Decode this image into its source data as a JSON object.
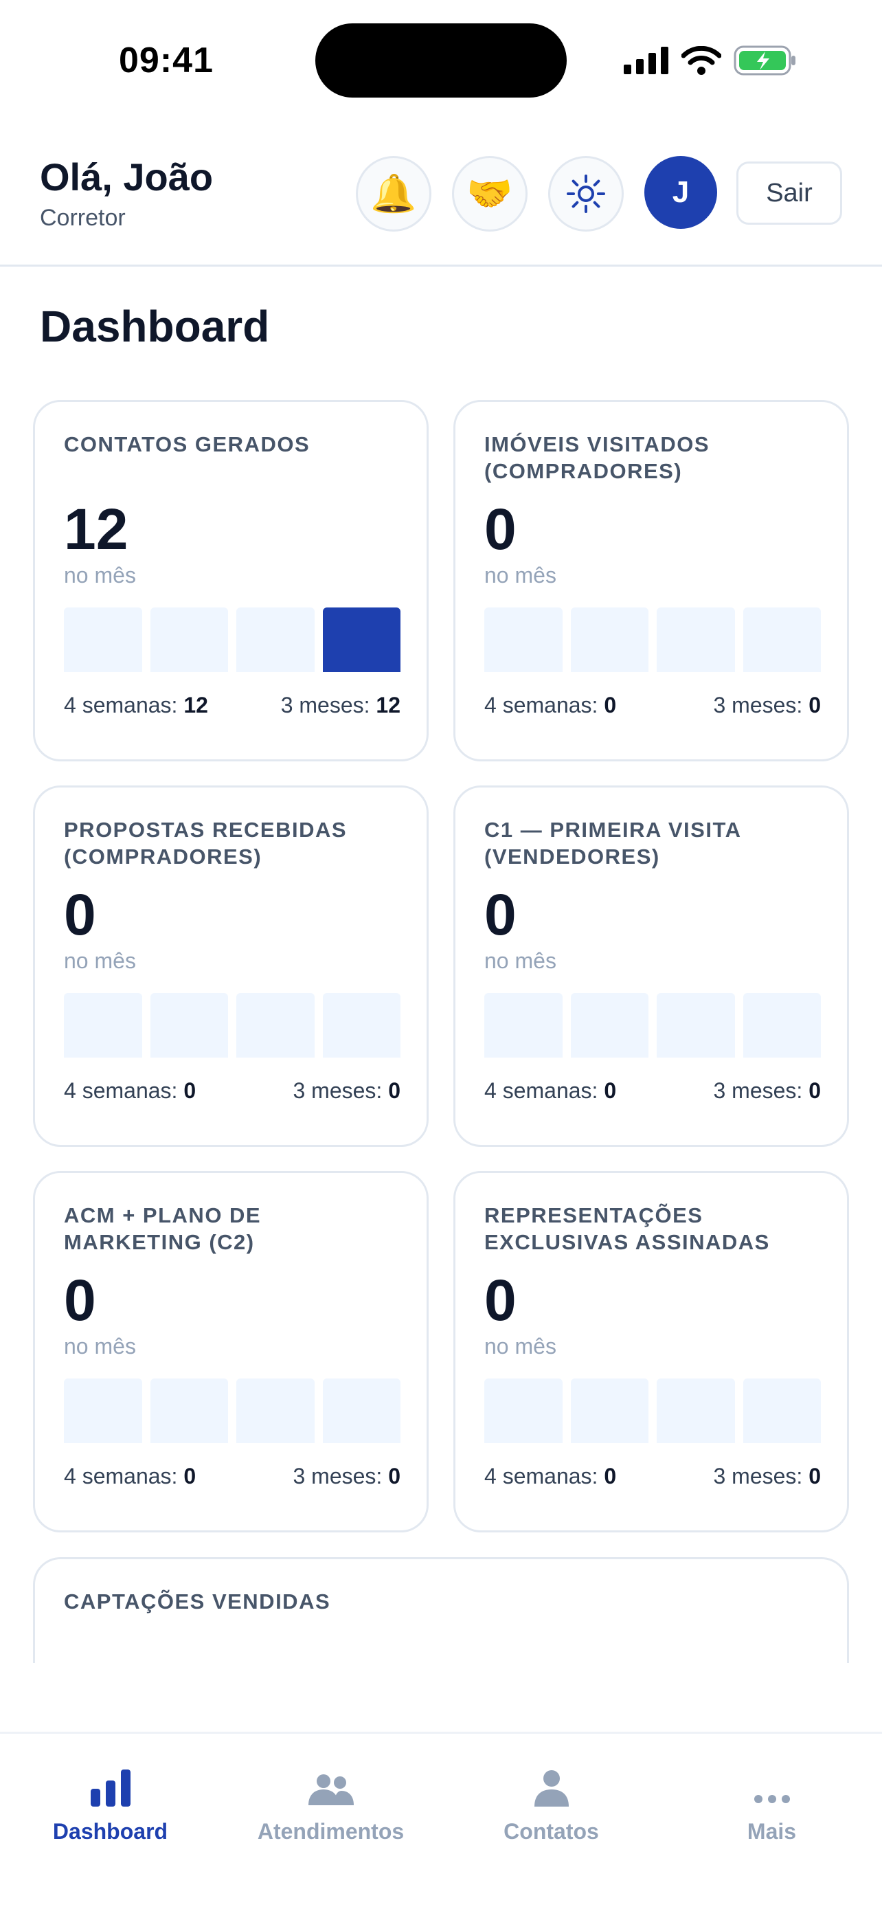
{
  "status_bar": {
    "time": "09:41"
  },
  "header": {
    "greeting": "Olá, João",
    "role": "Corretor",
    "notifications_icon": "bell-icon",
    "handshake_icon": "handshake-icon",
    "theme_icon": "sun-icon",
    "avatar_initial": "J",
    "logout_label": "Sair"
  },
  "page_title": "Dashboard",
  "cards": [
    {
      "title": "CONTATOS GERADOS",
      "value": "12",
      "period": "no mês",
      "bars": [
        0,
        0,
        0,
        12
      ],
      "weeks_label": "4 semanas:",
      "weeks_value": "12",
      "months_label": "3 meses:",
      "months_value": "12"
    },
    {
      "title": "IMÓVEIS VISITADOS (COMPRADORES)",
      "value": "0",
      "period": "no mês",
      "bars": [
        0,
        0,
        0,
        0
      ],
      "weeks_label": "4 semanas:",
      "weeks_value": "0",
      "months_label": "3 meses:",
      "months_value": "0"
    },
    {
      "title": "PROPOSTAS RECEBIDAS (COMPRADORES)",
      "value": "0",
      "period": "no mês",
      "bars": [
        0,
        0,
        0,
        0
      ],
      "weeks_label": "4 semanas:",
      "weeks_value": "0",
      "months_label": "3 meses:",
      "months_value": "0"
    },
    {
      "title": "C1 — PRIMEIRA VISITA (VENDEDORES)",
      "value": "0",
      "period": "no mês",
      "bars": [
        0,
        0,
        0,
        0
      ],
      "weeks_label": "4 semanas:",
      "weeks_value": "0",
      "months_label": "3 meses:",
      "months_value": "0"
    },
    {
      "title": "ACM + PLANO DE MARKETING (C2)",
      "value": "0",
      "period": "no mês",
      "bars": [
        0,
        0,
        0,
        0
      ],
      "weeks_label": "4 semanas:",
      "weeks_value": "0",
      "months_label": "3 meses:",
      "months_value": "0"
    },
    {
      "title": "REPRESENTAÇÕES EXCLUSIVAS ASSINADAS",
      "value": "0",
      "period": "no mês",
      "bars": [
        0,
        0,
        0,
        0
      ],
      "weeks_label": "4 semanas:",
      "weeks_value": "0",
      "months_label": "3 meses:",
      "months_value": "0"
    }
  ],
  "partial_card": {
    "title": "CAPTAÇÕES VENDIDAS"
  },
  "colors": {
    "accent": "#1e40af",
    "bar_empty": "#eff6ff",
    "muted": "#94a3b8"
  },
  "bottom_nav": [
    {
      "label": "Dashboard",
      "icon": "bar-chart-icon",
      "active": true
    },
    {
      "label": "Atendimentos",
      "icon": "users-icon",
      "active": false
    },
    {
      "label": "Contatos",
      "icon": "person-icon",
      "active": false
    },
    {
      "label": "Mais",
      "icon": "more-icon",
      "active": false
    }
  ]
}
